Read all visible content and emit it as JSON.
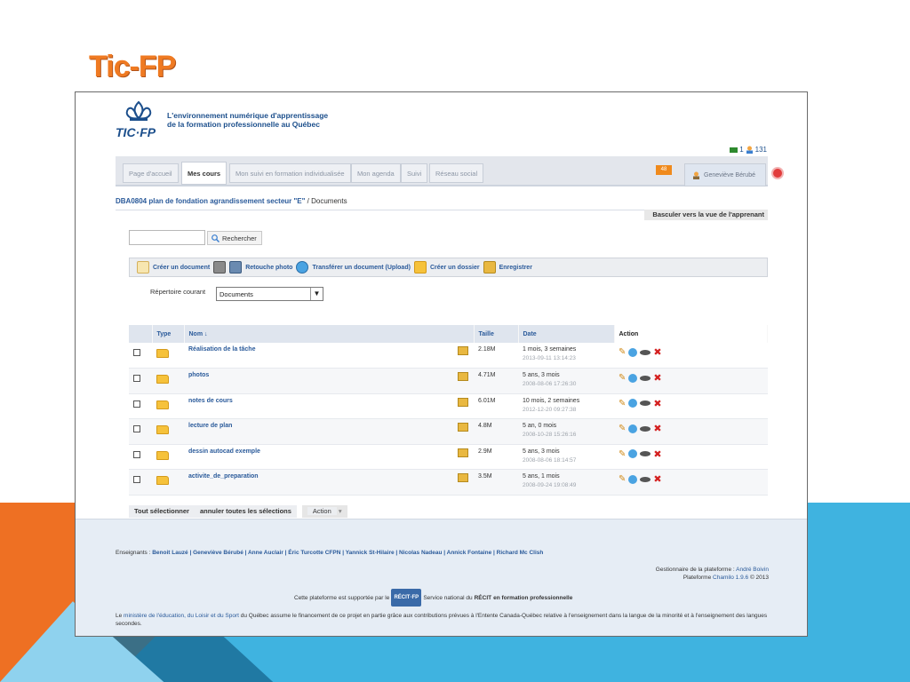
{
  "slide": {
    "title": "Tic-FP"
  },
  "header": {
    "logo_text": "TIC·FP",
    "tagline_line1": "L'environnement numérique d'apprentissage",
    "tagline_line2": "de la formation professionnelle au Québec",
    "user_count": "131"
  },
  "nav": {
    "tabs": [
      {
        "label": "Page d'accueil"
      },
      {
        "label": "Mes cours"
      },
      {
        "label": "Mon suivi en formation individualisée"
      },
      {
        "label": "Mon agenda"
      },
      {
        "label": "Suivi"
      },
      {
        "label": "Réseau social"
      }
    ],
    "notification_count": "48",
    "user_name": "Geneviève Bérubé"
  },
  "breadcrumb": {
    "course": "DBA0804 plan de fondation agrandissement secteur \"E\"",
    "separator": "/",
    "current": "Documents"
  },
  "switch_view_label": "Basculer vers la vue de l'apprenant",
  "search": {
    "value": "",
    "button_label": "Rechercher"
  },
  "toolbar": {
    "create_document": "Créer un document",
    "photo_retouch": "Retouche photo",
    "upload": "Transférer un document (Upload)",
    "create_folder": "Créer un dossier",
    "record": "Enregistrer"
  },
  "repository": {
    "label": "Répertoire courant",
    "selected": "Documents"
  },
  "table": {
    "headers": {
      "type": "Type",
      "name": "Nom ↓",
      "size": "Taille",
      "date": "Date",
      "action": "Action"
    },
    "rows": [
      {
        "name": "Réalisation de la tâche",
        "size": "2.18M",
        "date": "1 mois, 3 semaines",
        "timestamp": "2013-09-11 13:14:23"
      },
      {
        "name": "photos",
        "size": "4.71M",
        "date": "5 ans, 3 mois",
        "timestamp": "2008-08-06 17:26:30"
      },
      {
        "name": "notes de cours",
        "size": "6.01M",
        "date": "10 mois, 2 semaines",
        "timestamp": "2012-12-20 09:27:38"
      },
      {
        "name": "lecture de plan",
        "size": "4.8M",
        "date": "5 an, 0 mois",
        "timestamp": "2008-10-28 15:26:16"
      },
      {
        "name": "dessin autocad exemple",
        "size": "2.9M",
        "date": "5 ans, 3 mois",
        "timestamp": "2008-08-06 18:14:57"
      },
      {
        "name": "activite_de_preparation",
        "size": "3.5M",
        "date": "5 ans, 1 mois",
        "timestamp": "2008-09-24 19:08:49"
      }
    ]
  },
  "bulk": {
    "select_all": "Tout sélectionner",
    "unselect_all": "annuler toutes les sélections",
    "action": "Action"
  },
  "footer": {
    "teachers_label": "Enseignants :",
    "teachers": "Benoit Lauzé | Geneviève Bérubé | Anne Auclair | Éric Turcotte CFPN | Yannick St-Hilaire | Nicolas Nadeau | Annick Fontaine | Richard Mc Clish",
    "admin_label": "Gestionnaire de la plateforme :",
    "admin_name": "André Boivin",
    "platform_label": "Plateforme",
    "platform_name": "Chamilo 1.9.6",
    "copyright": "© 2013",
    "support_prefix": "Cette plateforme est supportée par le",
    "recit_logo": "RÉCIT·FP",
    "support_middle": "Service national du",
    "support_recit": "RÉCIT",
    "support_suffix": "en formation professionnelle",
    "ministry_prefix": "Le",
    "ministry_link": "ministère de l'éducation, du Loisir et du Sport",
    "ministry_text": "du Québec assume le financement de ce  projet  en partie grâce aux contributions prévues à l'Entente Canada-Québec relative à l'enseignement dans la langue de la minorité et à l'enseignement des langues secondes."
  },
  "colors": {
    "accent_orange": "#ef7a22",
    "link_blue": "#2a5a9a",
    "bg_blue": "#3fb3e0"
  }
}
